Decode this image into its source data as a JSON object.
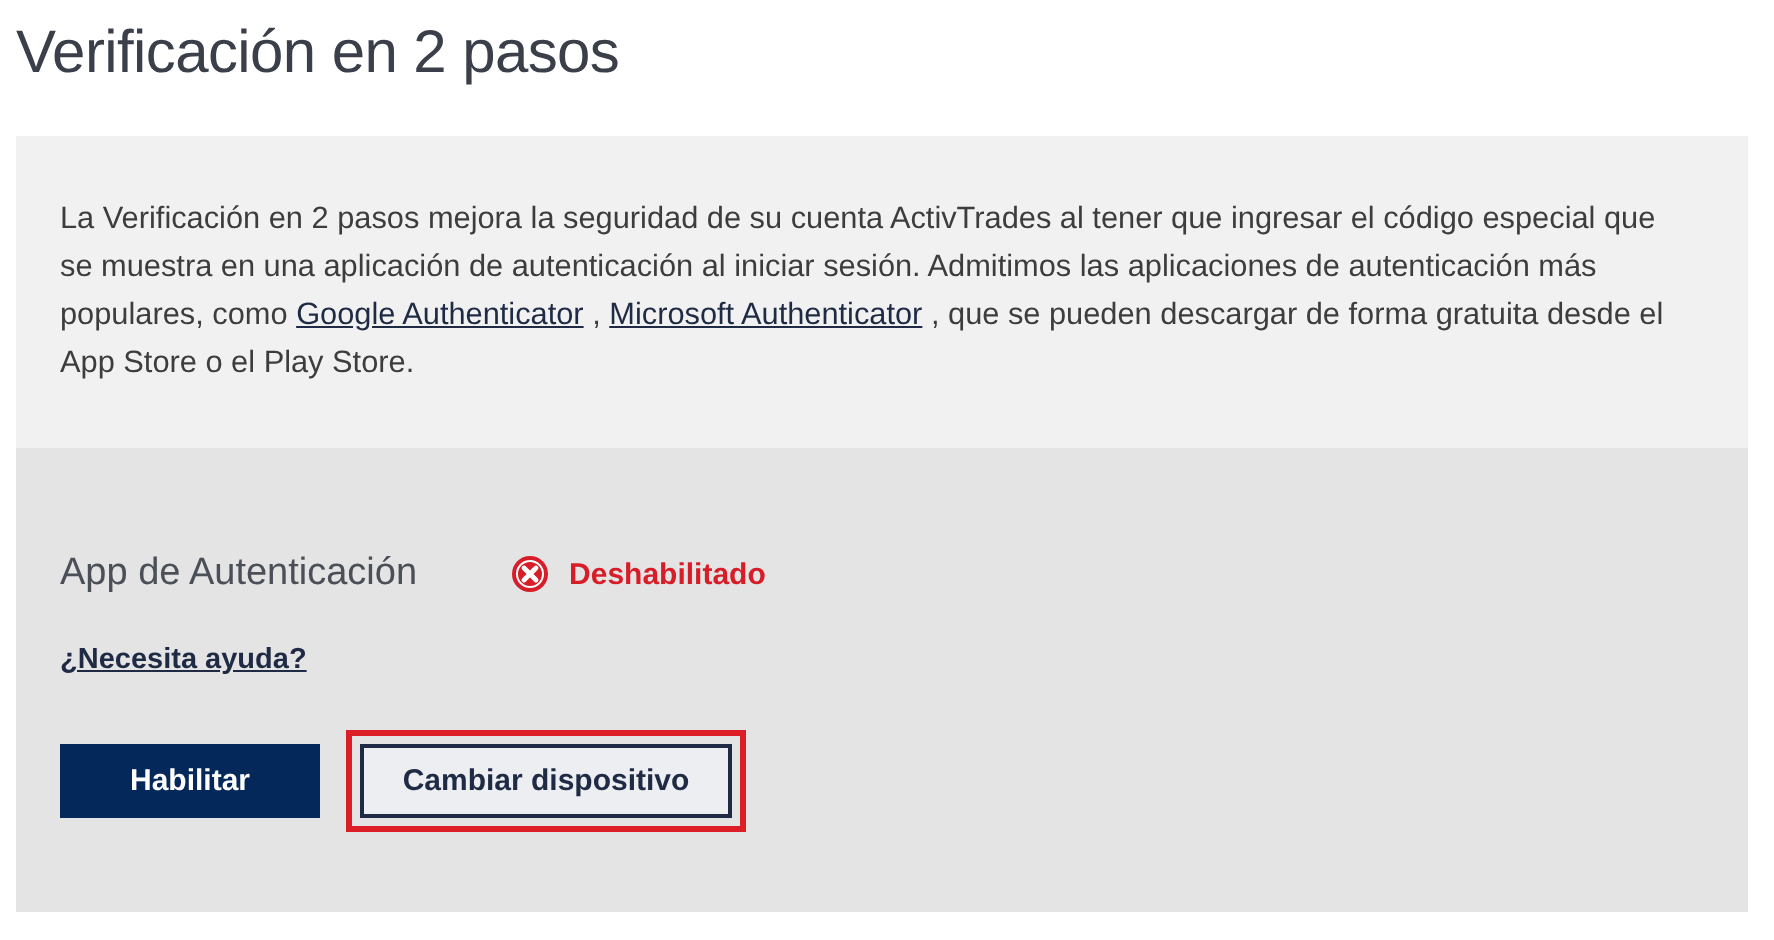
{
  "title": "Verificación en 2 pasos",
  "description": [
    {
      "kind": "text",
      "text": "La Verificación en 2 pasos mejora la seguridad de su cuenta ActivTrades al tener que ingresar el código especial que se muestra en una aplicación de autenticación al iniciar sesión. Admitimos las aplicaciones de autenticación más populares, como "
    },
    {
      "kind": "link",
      "text": "Google Authenticator"
    },
    {
      "kind": "text",
      "text": " , "
    },
    {
      "kind": "link",
      "text": "Microsoft Authenticator"
    },
    {
      "kind": "text",
      "text": " , que se pueden descargar de forma gratuita desde el App Store o el Play Store."
    }
  ],
  "auth_app": {
    "label": "App de Autenticación",
    "status": {
      "kind": "disabled",
      "text": "Deshabilitado"
    },
    "help_link": "¿Necesita ayuda?",
    "buttons": [
      {
        "kind": "primary",
        "label": "Habilitar",
        "highlighted": false
      },
      {
        "kind": "secondary",
        "label": "Cambiar dispositivo",
        "highlighted": true
      }
    ]
  }
}
